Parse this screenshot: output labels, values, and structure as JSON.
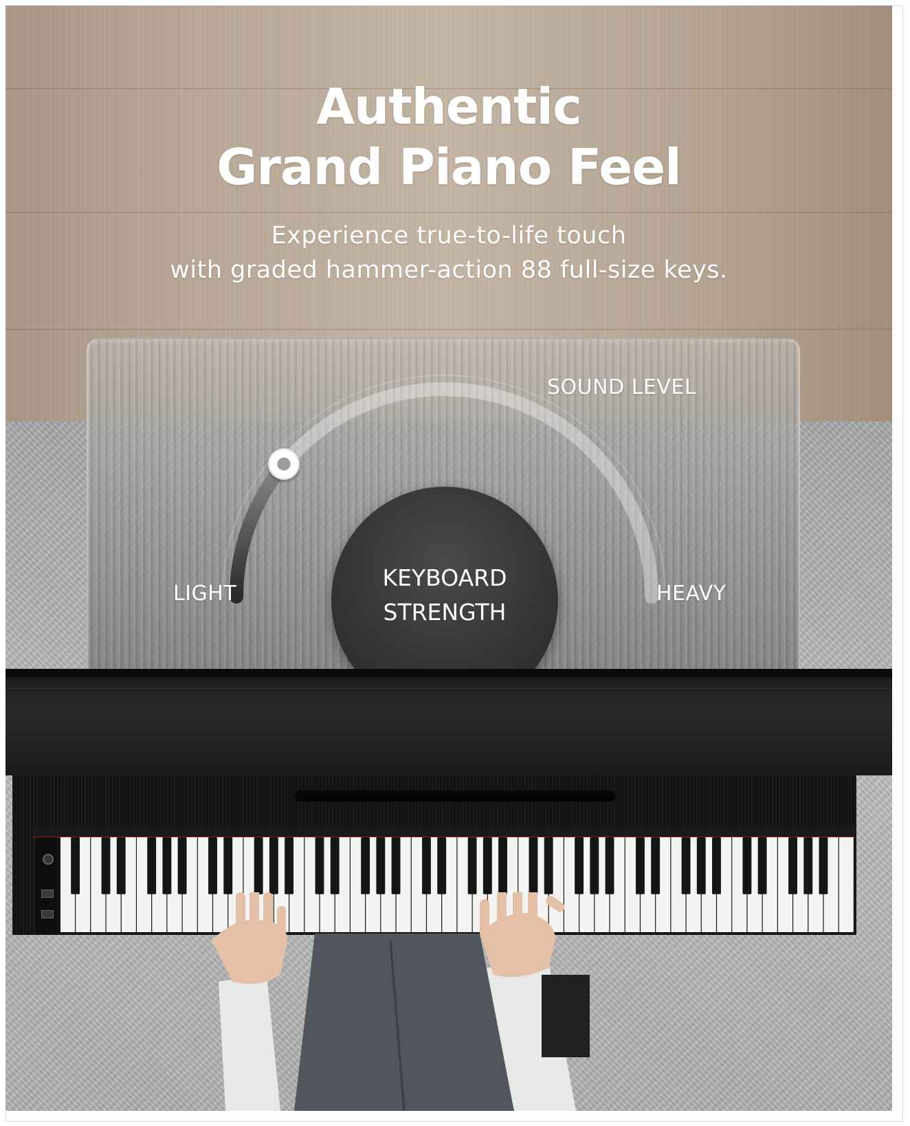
{
  "headline": {
    "line1": "Authentic",
    "line2": "Grand Piano Feel"
  },
  "subline": {
    "line1": "Experience true-to-life touch",
    "line2": "with graded hammer-action 88 full-size keys."
  },
  "dial": {
    "top_label": "SOUND LEVEL",
    "left_label": "LIGHT",
    "right_label": "HEAVY",
    "center_line1": "KEYBOARD",
    "center_line2": "STRENGTH",
    "level_fraction": 0.22
  },
  "piano": {
    "key_count": 88,
    "colors": {
      "body": "#121212",
      "accent_red": "#8a1d1d",
      "white_key": "#f4f4f2",
      "black_key": "#151515"
    }
  },
  "colors": {
    "text": "#ffffff",
    "core": "#333333"
  }
}
